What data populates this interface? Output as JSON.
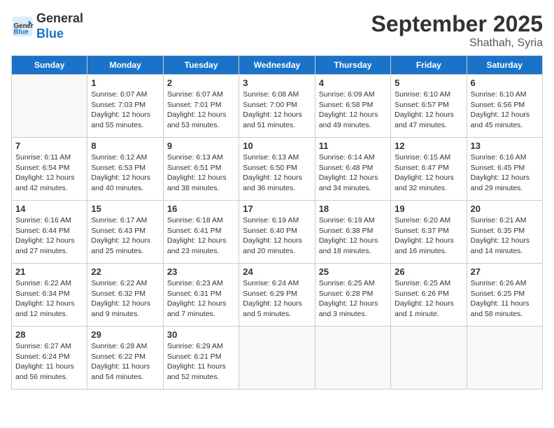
{
  "header": {
    "logo_line1": "General",
    "logo_line2": "Blue",
    "month": "September 2025",
    "location": "Shathah, Syria"
  },
  "days_of_week": [
    "Sunday",
    "Monday",
    "Tuesday",
    "Wednesday",
    "Thursday",
    "Friday",
    "Saturday"
  ],
  "weeks": [
    [
      {
        "day": "",
        "info": ""
      },
      {
        "day": "1",
        "info": "Sunrise: 6:07 AM\nSunset: 7:03 PM\nDaylight: 12 hours\nand 55 minutes."
      },
      {
        "day": "2",
        "info": "Sunrise: 6:07 AM\nSunset: 7:01 PM\nDaylight: 12 hours\nand 53 minutes."
      },
      {
        "day": "3",
        "info": "Sunrise: 6:08 AM\nSunset: 7:00 PM\nDaylight: 12 hours\nand 51 minutes."
      },
      {
        "day": "4",
        "info": "Sunrise: 6:09 AM\nSunset: 6:58 PM\nDaylight: 12 hours\nand 49 minutes."
      },
      {
        "day": "5",
        "info": "Sunrise: 6:10 AM\nSunset: 6:57 PM\nDaylight: 12 hours\nand 47 minutes."
      },
      {
        "day": "6",
        "info": "Sunrise: 6:10 AM\nSunset: 6:56 PM\nDaylight: 12 hours\nand 45 minutes."
      }
    ],
    [
      {
        "day": "7",
        "info": "Sunrise: 6:11 AM\nSunset: 6:54 PM\nDaylight: 12 hours\nand 42 minutes."
      },
      {
        "day": "8",
        "info": "Sunrise: 6:12 AM\nSunset: 6:53 PM\nDaylight: 12 hours\nand 40 minutes."
      },
      {
        "day": "9",
        "info": "Sunrise: 6:13 AM\nSunset: 6:51 PM\nDaylight: 12 hours\nand 38 minutes."
      },
      {
        "day": "10",
        "info": "Sunrise: 6:13 AM\nSunset: 6:50 PM\nDaylight: 12 hours\nand 36 minutes."
      },
      {
        "day": "11",
        "info": "Sunrise: 6:14 AM\nSunset: 6:48 PM\nDaylight: 12 hours\nand 34 minutes."
      },
      {
        "day": "12",
        "info": "Sunrise: 6:15 AM\nSunset: 6:47 PM\nDaylight: 12 hours\nand 32 minutes."
      },
      {
        "day": "13",
        "info": "Sunrise: 6:16 AM\nSunset: 6:45 PM\nDaylight: 12 hours\nand 29 minutes."
      }
    ],
    [
      {
        "day": "14",
        "info": "Sunrise: 6:16 AM\nSunset: 6:44 PM\nDaylight: 12 hours\nand 27 minutes."
      },
      {
        "day": "15",
        "info": "Sunrise: 6:17 AM\nSunset: 6:43 PM\nDaylight: 12 hours\nand 25 minutes."
      },
      {
        "day": "16",
        "info": "Sunrise: 6:18 AM\nSunset: 6:41 PM\nDaylight: 12 hours\nand 23 minutes."
      },
      {
        "day": "17",
        "info": "Sunrise: 6:19 AM\nSunset: 6:40 PM\nDaylight: 12 hours\nand 20 minutes."
      },
      {
        "day": "18",
        "info": "Sunrise: 6:19 AM\nSunset: 6:38 PM\nDaylight: 12 hours\nand 18 minutes."
      },
      {
        "day": "19",
        "info": "Sunrise: 6:20 AM\nSunset: 6:37 PM\nDaylight: 12 hours\nand 16 minutes."
      },
      {
        "day": "20",
        "info": "Sunrise: 6:21 AM\nSunset: 6:35 PM\nDaylight: 12 hours\nand 14 minutes."
      }
    ],
    [
      {
        "day": "21",
        "info": "Sunrise: 6:22 AM\nSunset: 6:34 PM\nDaylight: 12 hours\nand 12 minutes."
      },
      {
        "day": "22",
        "info": "Sunrise: 6:22 AM\nSunset: 6:32 PM\nDaylight: 12 hours\nand 9 minutes."
      },
      {
        "day": "23",
        "info": "Sunrise: 6:23 AM\nSunset: 6:31 PM\nDaylight: 12 hours\nand 7 minutes."
      },
      {
        "day": "24",
        "info": "Sunrise: 6:24 AM\nSunset: 6:29 PM\nDaylight: 12 hours\nand 5 minutes."
      },
      {
        "day": "25",
        "info": "Sunrise: 6:25 AM\nSunset: 6:28 PM\nDaylight: 12 hours\nand 3 minutes."
      },
      {
        "day": "26",
        "info": "Sunrise: 6:25 AM\nSunset: 6:26 PM\nDaylight: 12 hours\nand 1 minute."
      },
      {
        "day": "27",
        "info": "Sunrise: 6:26 AM\nSunset: 6:25 PM\nDaylight: 11 hours\nand 58 minutes."
      }
    ],
    [
      {
        "day": "28",
        "info": "Sunrise: 6:27 AM\nSunset: 6:24 PM\nDaylight: 11 hours\nand 56 minutes."
      },
      {
        "day": "29",
        "info": "Sunrise: 6:28 AM\nSunset: 6:22 PM\nDaylight: 11 hours\nand 54 minutes."
      },
      {
        "day": "30",
        "info": "Sunrise: 6:29 AM\nSunset: 6:21 PM\nDaylight: 11 hours\nand 52 minutes."
      },
      {
        "day": "",
        "info": ""
      },
      {
        "day": "",
        "info": ""
      },
      {
        "day": "",
        "info": ""
      },
      {
        "day": "",
        "info": ""
      }
    ]
  ]
}
